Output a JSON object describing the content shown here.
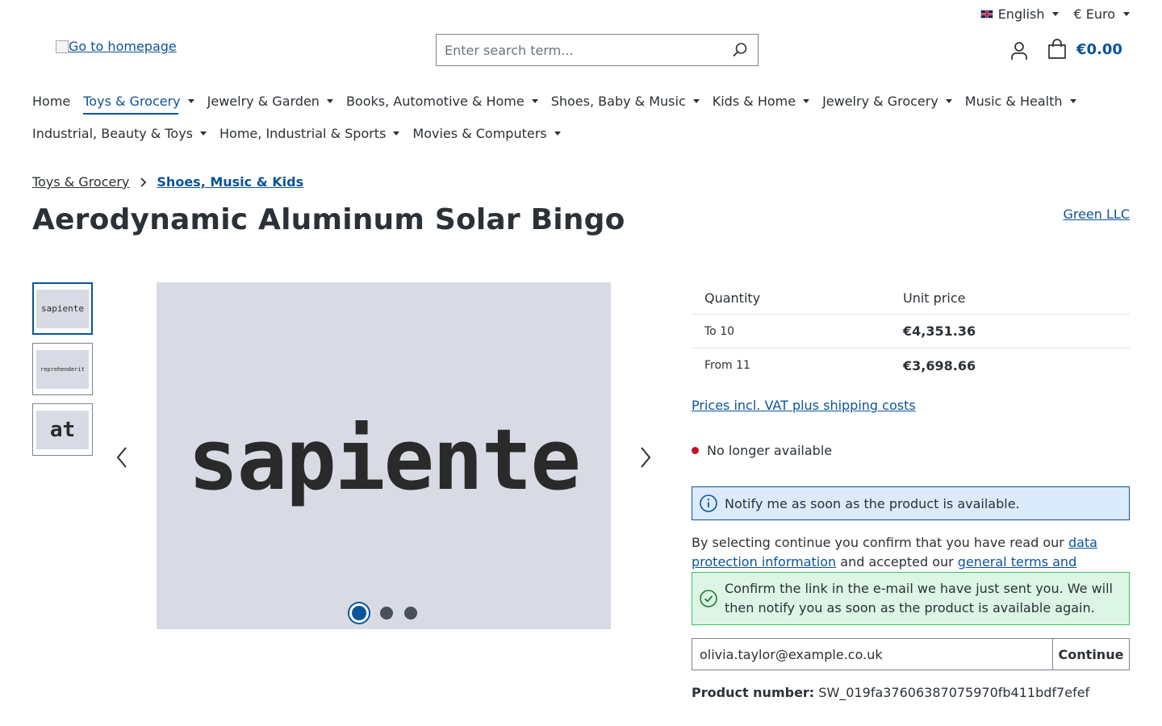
{
  "topbar": {
    "language": "English",
    "currency": "€ Euro"
  },
  "header": {
    "logo_alt": "Go to homepage",
    "search_placeholder": "Enter search term...",
    "cart_total": "€0.00"
  },
  "nav": [
    {
      "label": "Home",
      "dropdown": false,
      "active": false
    },
    {
      "label": "Toys & Grocery",
      "dropdown": true,
      "active": true
    },
    {
      "label": "Jewelry & Garden",
      "dropdown": true,
      "active": false
    },
    {
      "label": "Books, Automotive & Home",
      "dropdown": true,
      "active": false
    },
    {
      "label": "Shoes, Baby & Music",
      "dropdown": true,
      "active": false
    },
    {
      "label": "Kids & Home",
      "dropdown": true,
      "active": false
    },
    {
      "label": "Jewelry & Grocery",
      "dropdown": true,
      "active": false
    },
    {
      "label": "Music & Health",
      "dropdown": true,
      "active": false
    },
    {
      "label": "Industrial, Beauty & Toys",
      "dropdown": true,
      "active": false
    },
    {
      "label": "Home, Industrial & Sports",
      "dropdown": true,
      "active": false
    },
    {
      "label": "Movies & Computers",
      "dropdown": true,
      "active": false
    }
  ],
  "breadcrumb": {
    "parent": "Toys & Grocery",
    "current": "Shoes, Music & Kids"
  },
  "product": {
    "title": "Aerodynamic Aluminum Solar Bingo",
    "manufacturer": "Green LLC",
    "number_label": "Product number:",
    "number": "SW_019fa37606387075970fb411bdf7efef"
  },
  "gallery": {
    "thumbnails": [
      "sapiente",
      "reprehenderit",
      "at"
    ],
    "main_image_text": "sapiente",
    "active_index": 0,
    "slide_count": 3
  },
  "price_table": {
    "header_quantity": "Quantity",
    "header_price": "Unit price",
    "rows": [
      {
        "quantity": "To 10",
        "price": "€4,351.36"
      },
      {
        "quantity": "From 11",
        "price": "€3,698.66"
      }
    ]
  },
  "vat_link": "Prices incl. VAT plus shipping costs",
  "delivery_status": "No longer available",
  "notify_info": "Notify me as soon as the product is available.",
  "consent": {
    "text_before": "By selecting continue you confirm that you have read our ",
    "privacy_link": "data protection information",
    "text_middle": " and accepted our ",
    "terms_link": "general terms and conditions",
    "text_after": "."
  },
  "notify_success": "Confirm the link in the e-mail we have just sent you. We will then notify you as soon as the product is available again.",
  "notify_form": {
    "email_value": "olivia.taylor@example.co.uk",
    "submit_label": "Continue"
  },
  "colors": {
    "primary": "#0b539b",
    "text": "#2b3136",
    "info_bg": "#dbebfb",
    "success_bg": "#dcf5e4",
    "success_border": "#3cc261",
    "status_unavailable": "#c3122d",
    "image_bg": "#d8dae4"
  }
}
